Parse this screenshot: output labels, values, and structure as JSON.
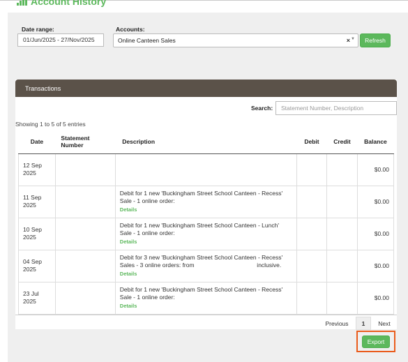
{
  "header": {
    "title": "Account History",
    "icon": "bar-chart-icon"
  },
  "filters": {
    "date_range_label": "Date range:",
    "date_range_value": "01/Jun/2025 - 27/Nov/2025",
    "accounts_label": "Accounts:",
    "accounts_value": "Online Canteen Sales",
    "clear_glyph": "×",
    "refresh_label": "Refresh"
  },
  "panel": {
    "title": "Transactions",
    "search_label": "Search:",
    "search_placeholder": "Statement Number, Description",
    "entries_info": "Showing 1 to 5 of 5 entries"
  },
  "table": {
    "columns": {
      "date": "Date",
      "statement": "Statement Number",
      "description": "Description",
      "debit": "Debit",
      "credit": "Credit",
      "balance": "Balance"
    },
    "rows": [
      {
        "date": "12 Sep 2025",
        "statement": "",
        "description": "",
        "details": "",
        "debit": "",
        "credit": "",
        "balance": "$0.00"
      },
      {
        "date": "11 Sep 2025",
        "statement": "",
        "description": "Debit for 1 new 'Buckingham Street School Canteen - Recess' Sale - 1 online order:",
        "details": "Details",
        "debit": "",
        "credit": "",
        "balance": "$0.00"
      },
      {
        "date": "10 Sep 2025",
        "statement": "",
        "description": "Debit for 1 new 'Buckingham Street School Canteen - Lunch' Sale - 1 online order:",
        "details": "Details",
        "debit": "",
        "credit": "",
        "balance": "$0.00"
      },
      {
        "date": "04 Sep 2025",
        "statement": "",
        "description": "Debit for 3 new 'Buckingham Street School Canteen - Recess' Sales - 3 online orders: from                                      inclusive.",
        "details": "Details",
        "debit": "",
        "credit": "",
        "balance": "$0.00"
      },
      {
        "date": "23 Jul 2025",
        "statement": "",
        "description": "Debit for 1 new 'Buckingham Street School Canteen - Recess' Sale - 1 online order:",
        "details": "Details",
        "debit": "",
        "credit": "",
        "balance": "$0.00"
      }
    ]
  },
  "pagination": {
    "previous": "Previous",
    "current_page": "1",
    "next": "Next"
  },
  "export_label": "Export",
  "colors": {
    "accent_green": "#5cb85c",
    "panel_heading": "#5b5249",
    "highlight": "#ea5b1b"
  }
}
